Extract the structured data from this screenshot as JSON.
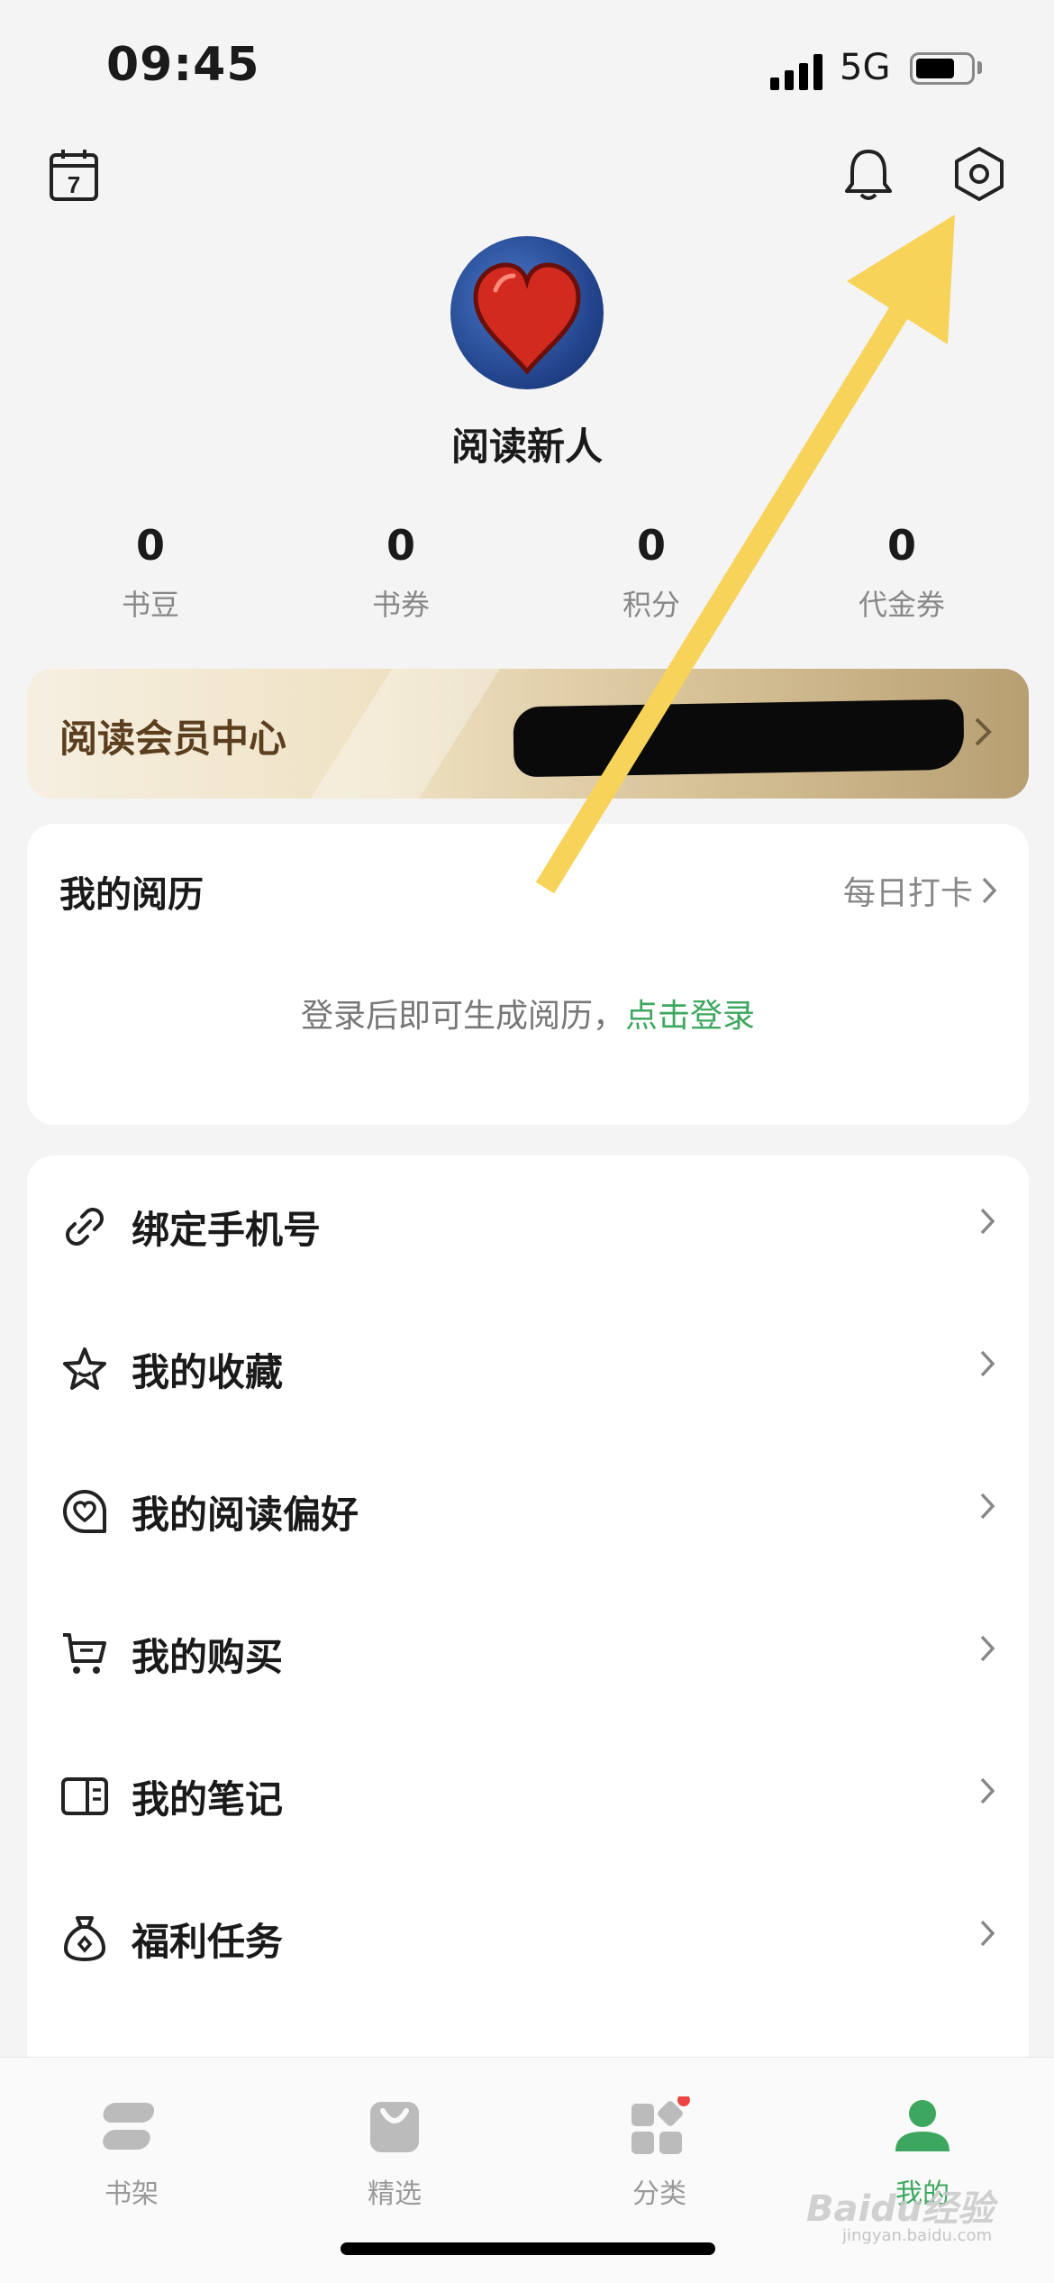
{
  "status_bar": {
    "time": "09:45",
    "network": "5G"
  },
  "top_icons": {
    "calendar_day": "7"
  },
  "profile": {
    "username": "阅读新人"
  },
  "stats": [
    {
      "value": "0",
      "label": "书豆"
    },
    {
      "value": "0",
      "label": "书券"
    },
    {
      "value": "0",
      "label": "积分"
    },
    {
      "value": "0",
      "label": "代金券"
    }
  ],
  "vip": {
    "title": "阅读会员中心"
  },
  "history": {
    "title": "我的阅历",
    "daily_checkin": "每日打卡",
    "message": "登录后即可生成阅历，",
    "login_link": "点击登录"
  },
  "menu": [
    {
      "label": "绑定手机号",
      "icon": "link-icon"
    },
    {
      "label": "我的收藏",
      "icon": "star-icon"
    },
    {
      "label": "我的阅读偏好",
      "icon": "heart-icon"
    },
    {
      "label": "我的购买",
      "icon": "cart-icon"
    },
    {
      "label": "我的笔记",
      "icon": "notebook-icon"
    },
    {
      "label": "福利任务",
      "icon": "money-bag-icon"
    }
  ],
  "tabs": [
    {
      "label": "书架",
      "icon": "bookshelf-icon"
    },
    {
      "label": "精选",
      "icon": "shopping-bag-icon"
    },
    {
      "label": "分类",
      "icon": "category-grid-icon"
    },
    {
      "label": "我的",
      "icon": "person-icon"
    }
  ],
  "watermark": {
    "text": "Baidu经验",
    "sub": "jingyan.baidu.com"
  },
  "colors": {
    "accent": "#3ea75f",
    "annotation_arrow": "#f7d35a",
    "badge": "#ef4444"
  }
}
